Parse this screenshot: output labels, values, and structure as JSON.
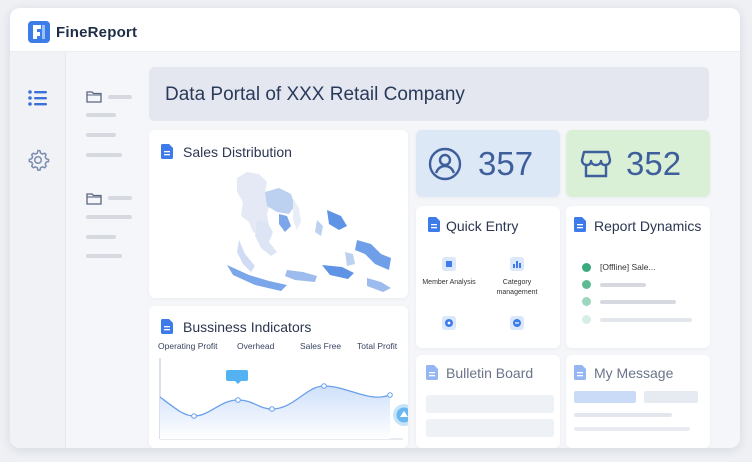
{
  "app": {
    "logo_text": "FineReport"
  },
  "header": {
    "title": "Data Portal of XXX Retail Company"
  },
  "sales": {
    "title": "Sales Distribution"
  },
  "kpi": {
    "users_value": "357",
    "stores_value": "352"
  },
  "quick_entry": {
    "title": "Quick Entry",
    "items": [
      {
        "label": "Member Analysis",
        "icon": "member-analysis-icon"
      },
      {
        "label": "Category management",
        "icon": "category-management-icon"
      },
      {
        "label": "",
        "icon": "compass-icon"
      },
      {
        "label": "",
        "icon": "search-icon"
      }
    ]
  },
  "report_dynamics": {
    "title": "Report Dynamics",
    "items": [
      {
        "text": "[Offline]  Sale...",
        "color": "#3aa97d"
      },
      {
        "text": "",
        "color": "#5dbb93"
      },
      {
        "text": "",
        "color": "#9dd6bd"
      },
      {
        "text": "",
        "color": "#d6efe4"
      }
    ]
  },
  "business": {
    "title": "Bussiness Indicators",
    "columns": [
      "Operating Profit",
      "Overhead",
      "Sales Free",
      "Total Profit"
    ]
  },
  "bulletin": {
    "title": "Bulletin Board"
  },
  "message": {
    "title": "My Message"
  },
  "colors": {
    "accent": "#3d7bea",
    "kpi_blue_bg": "#dde8f7",
    "kpi_green_bg": "#daf0d6",
    "kpi_text": "#3e5f9b"
  }
}
